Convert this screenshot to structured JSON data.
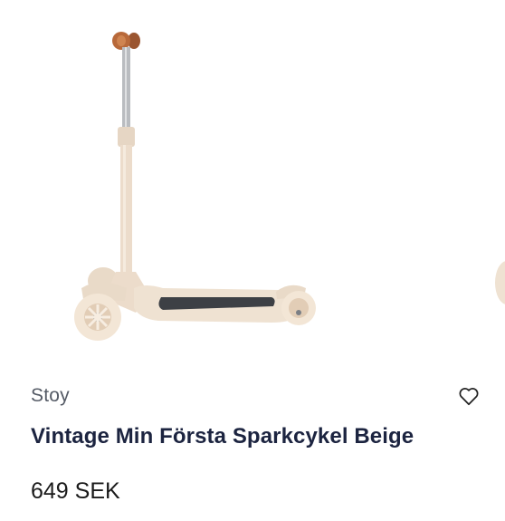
{
  "product": {
    "brand": "Stoy",
    "title": "Vintage Min Första Sparkcykel Beige",
    "price": "649 SEK",
    "image_subject": "kick-scooter",
    "wishlist_icon": "heart-outline-icon"
  },
  "colors": {
    "scooter_body": "#efe2d2",
    "deck_grip": "#3d4045",
    "handle_knob": "#b8693a",
    "stem_metal": "#b9bcc0",
    "title_text": "#1c2440",
    "brand_text": "#555b66"
  }
}
